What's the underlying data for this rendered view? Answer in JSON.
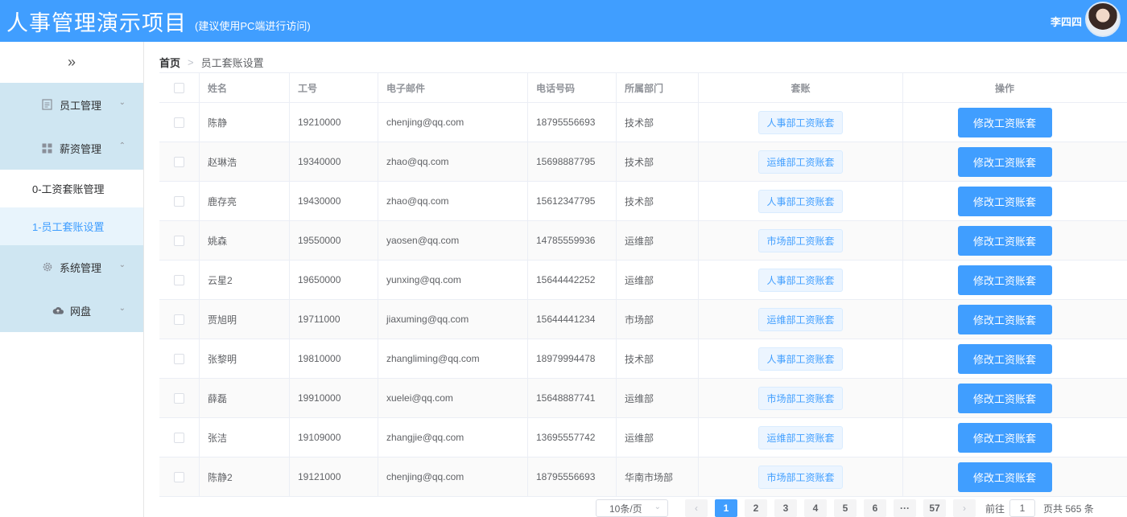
{
  "header": {
    "title": "人事管理演示项目",
    "subtitle": "(建议使用PC端进行访问)",
    "user_name": "李四四"
  },
  "sidebar": {
    "collapse_icon": "»",
    "menus": [
      {
        "label": "员工管理",
        "icon": "document-icon"
      },
      {
        "label": "薪资管理",
        "icon": "grid-icon"
      },
      {
        "label": "系统管理",
        "icon": "gear-icon"
      },
      {
        "label": "网盘",
        "icon": "cloud-icon"
      }
    ],
    "submenu": [
      "0-工资套账管理",
      "1-员工套账设置"
    ]
  },
  "breadcrumb": {
    "home": "首页",
    "current": "员工套账设置"
  },
  "table": {
    "columns": [
      "姓名",
      "工号",
      "电子邮件",
      "电话号码",
      "所属部门",
      "套账",
      "操作"
    ],
    "rows": [
      {
        "name": "陈静",
        "id": "19210000",
        "email": "chenjing@qq.com",
        "phone": "18795556693",
        "dept": "技术部",
        "plan": "人事部工资账套",
        "action": "修改工资账套"
      },
      {
        "name": "赵琳浩",
        "id": "19340000",
        "email": "zhao@qq.com",
        "phone": "15698887795",
        "dept": "技术部",
        "plan": "运维部工资账套",
        "action": "修改工资账套"
      },
      {
        "name": "鹿存亮",
        "id": "19430000",
        "email": "zhao@qq.com",
        "phone": "15612347795",
        "dept": "技术部",
        "plan": "人事部工资账套",
        "action": "修改工资账套"
      },
      {
        "name": "姚森",
        "id": "19550000",
        "email": "yaosen@qq.com",
        "phone": "14785559936",
        "dept": "运维部",
        "plan": "市场部工资账套",
        "action": "修改工资账套"
      },
      {
        "name": "云星2",
        "id": "19650000",
        "email": "yunxing@qq.com",
        "phone": "15644442252",
        "dept": "运维部",
        "plan": "人事部工资账套",
        "action": "修改工资账套"
      },
      {
        "name": "贾旭明",
        "id": "19711000",
        "email": "jiaxuming@qq.com",
        "phone": "15644441234",
        "dept": "市场部",
        "plan": "运维部工资账套",
        "action": "修改工资账套"
      },
      {
        "name": "张黎明",
        "id": "19810000",
        "email": "zhangliming@qq.com",
        "phone": "18979994478",
        "dept": "技术部",
        "plan": "人事部工资账套",
        "action": "修改工资账套"
      },
      {
        "name": "薛磊",
        "id": "19910000",
        "email": "xuelei@qq.com",
        "phone": "15648887741",
        "dept": "运维部",
        "plan": "市场部工资账套",
        "action": "修改工资账套"
      },
      {
        "name": "张洁",
        "id": "19109000",
        "email": "zhangjie@qq.com",
        "phone": "13695557742",
        "dept": "运维部",
        "plan": "运维部工资账套",
        "action": "修改工资账套"
      },
      {
        "name": "陈静2",
        "id": "19121000",
        "email": "chenjing@qq.com",
        "phone": "18795556693",
        "dept": "华南市场部",
        "plan": "市场部工资账套",
        "action": "修改工资账套"
      }
    ]
  },
  "pagination": {
    "page_size": "10条/页",
    "prev": "‹",
    "pages": [
      "1",
      "2",
      "3",
      "4",
      "5",
      "6"
    ],
    "ellipsis": "···",
    "last": "57",
    "next": "›",
    "goto_label": "前往",
    "goto_value": "1",
    "total_text": "页共 565 条",
    "current_page": 1
  },
  "colors": {
    "primary": "#409eff",
    "menu_bg": "#cfe6f2",
    "tag_bg": "#ecf5ff"
  }
}
